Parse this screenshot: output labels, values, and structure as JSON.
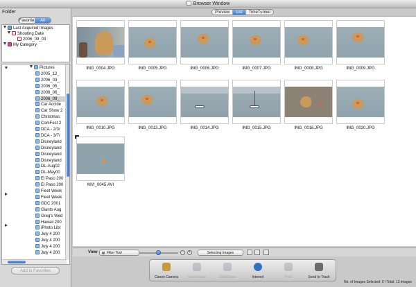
{
  "window": {
    "title": "Browser Window"
  },
  "left_panel": {
    "header": "Folder",
    "tabs": [
      {
        "label": "Favorite",
        "selected": false
      },
      {
        "label": "All",
        "selected": true
      }
    ],
    "top_tree": [
      {
        "label": "Last Acquired Images",
        "icon": "camera-icon",
        "expanded": true
      },
      {
        "label": "Shooting Date",
        "icon": "calendar-icon",
        "expanded": true
      },
      {
        "label": "2006_09_03",
        "icon": "calendar-icon"
      },
      {
        "label": "My Category",
        "icon": "category-icon",
        "expanded": true
      }
    ],
    "folder_tree": [
      {
        "label": "Pictures",
        "icon": "folder-icon",
        "expanded": true
      },
      {
        "label": "2005_12_"
      },
      {
        "label": "2006_03_"
      },
      {
        "label": "2006_05_"
      },
      {
        "label": "2006_06_"
      },
      {
        "label": "2006_09_",
        "selected": true
      },
      {
        "label": "Car Accide"
      },
      {
        "label": "Car Show 2"
      },
      {
        "label": "Christmas"
      },
      {
        "label": "ComFest 2"
      },
      {
        "label": "DCA - 2/3/"
      },
      {
        "label": "DCA - 3/7/"
      },
      {
        "label": "Disneyland"
      },
      {
        "label": "Disneyland"
      },
      {
        "label": "Disneyland"
      },
      {
        "label": "Disneyland"
      },
      {
        "label": "DL-Aug02"
      },
      {
        "label": "DL-May00"
      },
      {
        "label": "El Paso 200"
      },
      {
        "label": "El Paso 200"
      },
      {
        "label": "Fleet Week"
      },
      {
        "label": "Fleet Week"
      },
      {
        "label": "GDC 2001"
      },
      {
        "label": "Giants Aug"
      },
      {
        "label": "Greg's Wed"
      },
      {
        "label": "Hawaii 200"
      },
      {
        "label": "iPhoto Libr"
      },
      {
        "label": "July 4 200"
      },
      {
        "label": "July 4 200"
      },
      {
        "label": "July 4 200"
      },
      {
        "label": "July 4 200"
      }
    ],
    "add_to_favorites": "Add to Favorites"
  },
  "view_tabs": [
    {
      "label": "Preview",
      "selected": false
    },
    {
      "label": "List",
      "selected": true
    },
    {
      "label": "TimeTunnel",
      "selected": false
    }
  ],
  "thumbnails": [
    {
      "name": "IMG_0004.JPG",
      "scene": "close"
    },
    {
      "name": "IMG_0005.JPG",
      "scene": "water"
    },
    {
      "name": "IMG_0006.JPG",
      "scene": "water"
    },
    {
      "name": "IMG_0007.JPG",
      "scene": "water"
    },
    {
      "name": "IMG_0008.JPG",
      "scene": "water"
    },
    {
      "name": "IMG_0009.JPG",
      "scene": "water"
    },
    {
      "name": "IMG_0010.JPG",
      "scene": "water"
    },
    {
      "name": "IMG_0013.JPG",
      "scene": "water"
    },
    {
      "name": "IMG_0014.JPG",
      "scene": "boat"
    },
    {
      "name": "IMG_0015.JPG",
      "scene": "boat"
    },
    {
      "name": "IMG_0016.JPG",
      "scene": "sand"
    },
    {
      "name": "IMG_0020.JPG",
      "scene": "water"
    },
    {
      "name": "MVI_0045.AVI",
      "scene": "movie"
    }
  ],
  "view_bar": {
    "label": "View",
    "filter": "Filter Tool",
    "zoom_level": 0.5,
    "selecting": "Selecting Images"
  },
  "actions": [
    {
      "label": "Canon Camera",
      "icon": "camera-icon",
      "enabled": true
    },
    {
      "label": "View Image",
      "icon": "view-image-icon",
      "enabled": false
    },
    {
      "label": "SlideShow",
      "icon": "slideshow-icon",
      "enabled": false
    },
    {
      "label": "Internet",
      "icon": "globe-icon",
      "enabled": true
    },
    {
      "label": "Print",
      "icon": "printer-icon",
      "enabled": false
    },
    {
      "label": "Send to Trash",
      "icon": "trash-icon",
      "enabled": true
    }
  ],
  "status": "No. of Images Selected: 0 / Total: 13 images",
  "colors": {
    "accent": "#3f7fd6",
    "water": "#8fa3ad",
    "sand": "#8c8276"
  }
}
